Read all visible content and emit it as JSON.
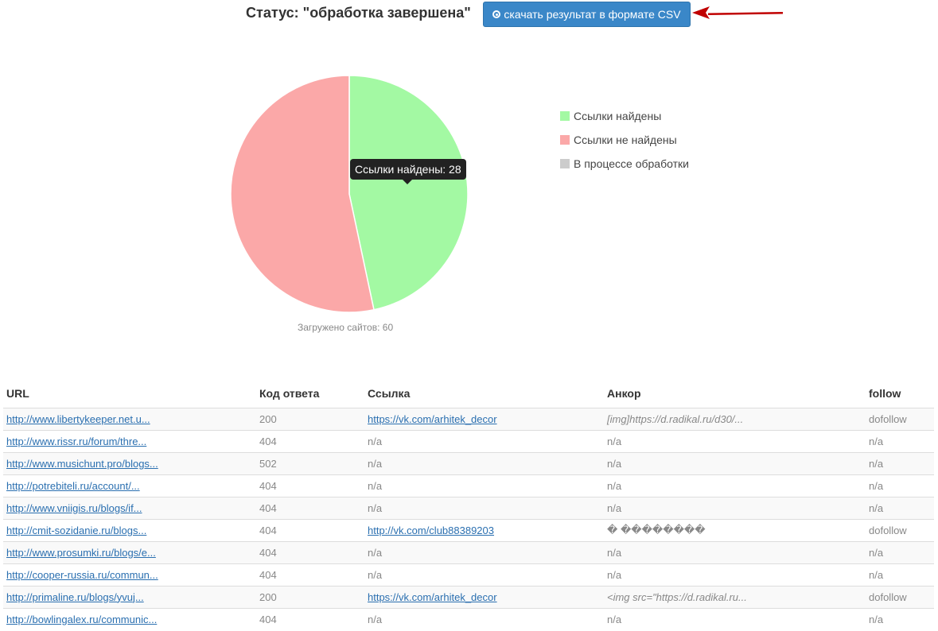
{
  "header": {
    "status_title": "Статус: \"обработка завершена\"",
    "csv_button_label": "скачать результат в формате CSV"
  },
  "chart_data": {
    "type": "pie",
    "slices": [
      {
        "label": "Ссылки найдены",
        "value": 28,
        "color": "#a3f9a3"
      },
      {
        "label": "Ссылки не найдены",
        "value": 32,
        "color": "#fba8a8"
      },
      {
        "label": "В процессе обработки",
        "value": 0,
        "color": "#cccccc"
      }
    ],
    "tooltip": "Ссылки найдены: 28",
    "caption": "Загружено сайтов: 60",
    "legend_position": "right"
  },
  "table": {
    "columns": [
      "URL",
      "Код ответа",
      "Ссылка",
      "Анкор",
      "follow"
    ],
    "rows": [
      {
        "url": "http://www.libertykeeper.net.u...",
        "code": "200",
        "link": "https://vk.com/arhitek_decor",
        "anchor": "[img]https://d.radikal.ru/d30/...",
        "follow": "dofollow"
      },
      {
        "url": "http://www.rissr.ru/forum/thre...",
        "code": "404",
        "link": "n/a",
        "anchor": "n/a",
        "follow": "n/a"
      },
      {
        "url": "http://www.musichunt.pro/blogs...",
        "code": "502",
        "link": "n/a",
        "anchor": "n/a",
        "follow": "n/a"
      },
      {
        "url": "http://potrebiteli.ru/account/...",
        "code": "404",
        "link": "n/a",
        "anchor": "n/a",
        "follow": "n/a"
      },
      {
        "url": "http://www.vniigis.ru/blogs/if...",
        "code": "404",
        "link": "n/a",
        "anchor": "n/a",
        "follow": "n/a"
      },
      {
        "url": "http://cmit-sozidanie.ru/blogs...",
        "code": "404",
        "link": "http://vk.com/club88389203",
        "anchor": "� ��������",
        "follow": "dofollow"
      },
      {
        "url": "http://www.prosumki.ru/blogs/e...",
        "code": "404",
        "link": "n/a",
        "anchor": "n/a",
        "follow": "n/a"
      },
      {
        "url": "http://cooper-russia.ru/commun...",
        "code": "404",
        "link": "n/a",
        "anchor": "n/a",
        "follow": "n/a"
      },
      {
        "url": "http://primaline.ru/blogs/yvuj...",
        "code": "200",
        "link": "https://vk.com/arhitek_decor",
        "anchor": "<img src=\"https://d.radikal.ru...",
        "follow": "dofollow"
      },
      {
        "url": "http://bowlingalex.ru/communic...",
        "code": "404",
        "link": "n/a",
        "anchor": "n/a",
        "follow": "n/a"
      }
    ]
  },
  "colors": {
    "button_blue": "#3a87c8",
    "arrow_red": "#c00000",
    "error_code": "#f0908f",
    "link_blue": "#2a6fb0"
  }
}
